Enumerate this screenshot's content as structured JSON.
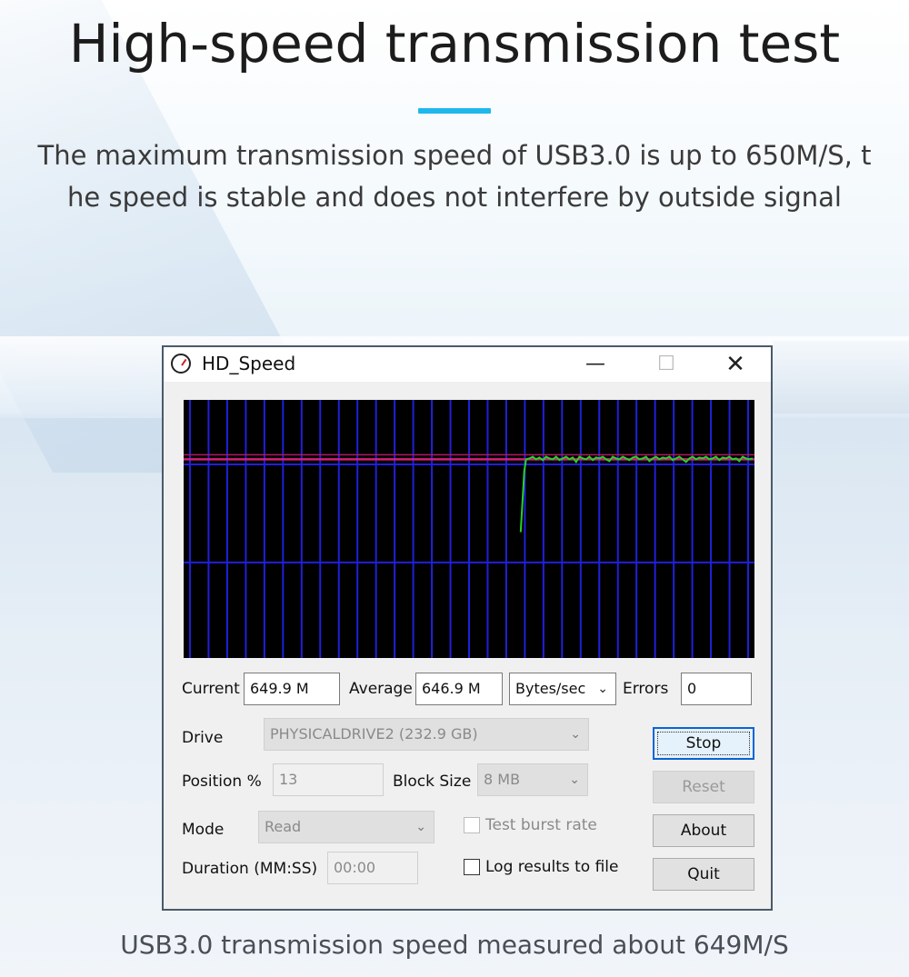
{
  "page": {
    "title": "High-speed transmission test",
    "subtitle_line1": "The maximum transmission speed of USB3.0 is up to 650M/S, t",
    "subtitle_line2": "he speed is stable and does not interfere by outside signal",
    "caption": "USB3.0 transmission speed measured about 649M/S",
    "accent_color": "#1fb7ec"
  },
  "window": {
    "title": "HD_Speed",
    "icon": "stopwatch-icon",
    "minimize_glyph": "—",
    "maximize_glyph": "☐",
    "close_glyph": "✕"
  },
  "stats": {
    "current_label": "Current",
    "current_value": "649.9 M",
    "average_label": "Average",
    "average_value": "646.9 M",
    "unit_value": "Bytes/sec",
    "errors_label": "Errors",
    "errors_value": "0"
  },
  "settings": {
    "drive_label": "Drive",
    "drive_value": "PHYSICALDRIVE2 (232.9 GB)",
    "position_label": "Position %",
    "position_value": "13",
    "block_size_label": "Block Size",
    "block_size_value": "8 MB",
    "mode_label": "Mode",
    "mode_value": "Read",
    "duration_label": "Duration (MM:SS)",
    "duration_value": "00:00",
    "burst_label": "Test burst rate",
    "log_label": "Log results to file"
  },
  "buttons": {
    "stop": "Stop",
    "reset": "Reset",
    "about": "About",
    "quit": "Quit"
  },
  "graph": {
    "trace_color": "#28d228",
    "average_line_color": "#d2207a",
    "grid_color": "#2020d8",
    "speed_trace": [
      0.57,
      0.92,
      0.985,
      0.99,
      1.0,
      0.985,
      0.995,
      0.98,
      1.0,
      0.99,
      0.985,
      1.0,
      0.98,
      0.99,
      1.0,
      0.985,
      0.995,
      0.97,
      1.0,
      0.99,
      0.985,
      1.0,
      0.98,
      0.995,
      0.99,
      1.0,
      0.985,
      0.975,
      1.0,
      0.99,
      0.985,
      1.0,
      0.99,
      0.98,
      0.995,
      1.0,
      0.985,
      0.99,
      1.0,
      0.975,
      0.99,
      1.0,
      0.985,
      0.995,
      0.99,
      1.0,
      0.98,
      0.99,
      1.0,
      0.985,
      0.97,
      0.99,
      1.0,
      0.985,
      0.995,
      0.99,
      1.0,
      0.985,
      0.99,
      1.0,
      0.98,
      0.995,
      0.99,
      1.0,
      0.985,
      0.99,
      0.975,
      1.0,
      0.99,
      0.985,
      0.99
    ]
  }
}
